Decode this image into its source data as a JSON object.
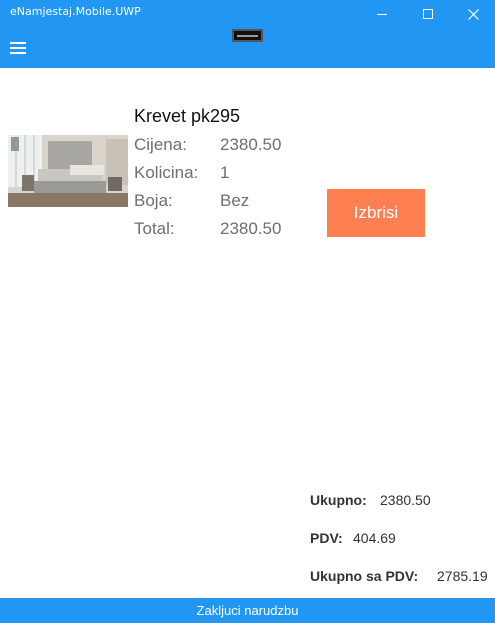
{
  "window": {
    "title": "eNamjestaj.Mobile.UWP",
    "controls": {
      "minimize_icon": "minimize-icon",
      "maximize_icon": "maximize-icon",
      "close_glyph": "✕"
    }
  },
  "commandbar": {
    "menu_icon": "hamburger-menu-icon"
  },
  "cart_item": {
    "name": "Krevet pk295",
    "image_icon": "product-photo-bed",
    "price_label": "Cijena:",
    "price_value": "2380.50",
    "quantity_label": "Kolicina:",
    "quantity_value": "1",
    "color_label": "Boja:",
    "color_value": "Bez",
    "total_label": "Total:",
    "total_value": "2380.50",
    "delete_label": "Izbrisi"
  },
  "summary": {
    "total_label": "Ukupno:",
    "total_value": "2380.50",
    "vat_label": "PDV:",
    "vat_value": "404.69",
    "total_with_vat_label": "Ukupno sa PDV:",
    "total_with_vat_value": "2785.19"
  },
  "footer": {
    "checkout_label": "Zakljuci narudzbu"
  },
  "colors": {
    "accent": "#2196f3",
    "delete_button": "#ff7f50",
    "secondary_text": "#6f6f6f",
    "summary_text": "#333333"
  }
}
